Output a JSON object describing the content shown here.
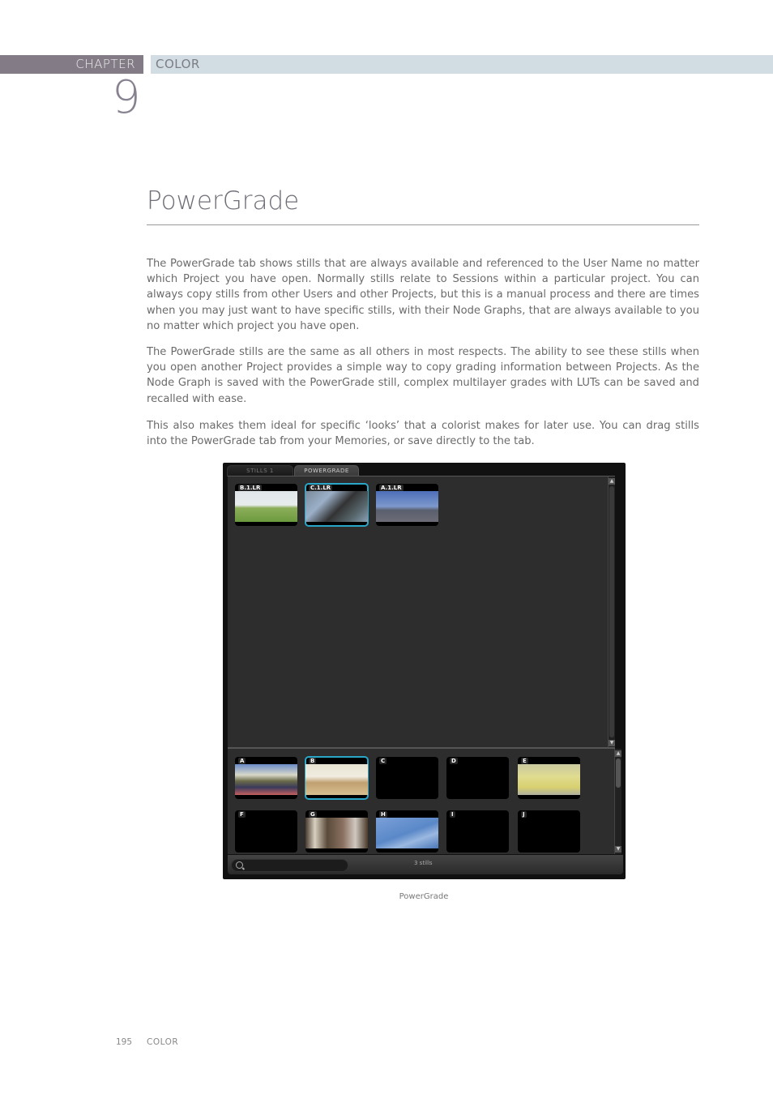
{
  "header": {
    "chapter_label": "CHAPTER",
    "section_label": "COLOR",
    "chapter_number": "9",
    "colors": {
      "chapter_bar": "#837c87",
      "section_bar": "#d1dde2"
    }
  },
  "title": "PowerGrade",
  "paragraphs": [
    "The PowerGrade tab shows stills that are always available and referenced to the User Name no matter which Project you have open. Normally stills relate to Sessions within a particular project. You can always copy stills from other Users and other Projects, but this is a manual process and there are times when you may just want to have specific stills, with their Node Graphs, that are always available to you no matter which project you have open.",
    "The PowerGrade stills are the same as all others in most respects. The ability to see these stills when you open another Project provides a simple way to copy grading information between Projects. As the Node Graph is saved with the PowerGrade still, complex multilayer grades with LUTs can be saved and recalled with ease.",
    "This also makes them ideal for specific ‘looks’ that a colorist makes for later use. You can drag stills into the PowerGrade tab from your Memories, or save directly to the tab."
  ],
  "screenshot": {
    "tabs": [
      {
        "label": "STILLS 1",
        "active": false
      },
      {
        "label": "POWERGRADE",
        "active": true
      }
    ],
    "powergrade_stills": [
      {
        "label": "B.1.LR",
        "selected": false,
        "scene": "golf course"
      },
      {
        "label": "C.1.LR",
        "selected": true,
        "scene": "statue in fountain"
      },
      {
        "label": "A.1.LR",
        "selected": false,
        "scene": "highway traffic"
      }
    ],
    "memories": [
      {
        "label": "A",
        "selected": false,
        "empty": false,
        "scene": "runners on track"
      },
      {
        "label": "B",
        "selected": true,
        "empty": false,
        "scene": "beach basketball"
      },
      {
        "label": "C",
        "selected": false,
        "empty": true
      },
      {
        "label": "D",
        "selected": false,
        "empty": true
      },
      {
        "label": "E",
        "selected": false,
        "empty": false,
        "scene": "yellow building"
      },
      {
        "label": "F",
        "selected": false,
        "empty": true
      },
      {
        "label": "G",
        "selected": false,
        "empty": false,
        "scene": "boy in church"
      },
      {
        "label": "H",
        "selected": false,
        "empty": false,
        "scene": "airplane in sky"
      },
      {
        "label": "I",
        "selected": false,
        "empty": true
      },
      {
        "label": "J",
        "selected": false,
        "empty": true
      }
    ],
    "search_placeholder": "",
    "still_count": "3 stills",
    "accent": "#2aa6c8"
  },
  "caption": "PowerGrade",
  "footer": {
    "page_number": "195",
    "section": "COLOR"
  }
}
